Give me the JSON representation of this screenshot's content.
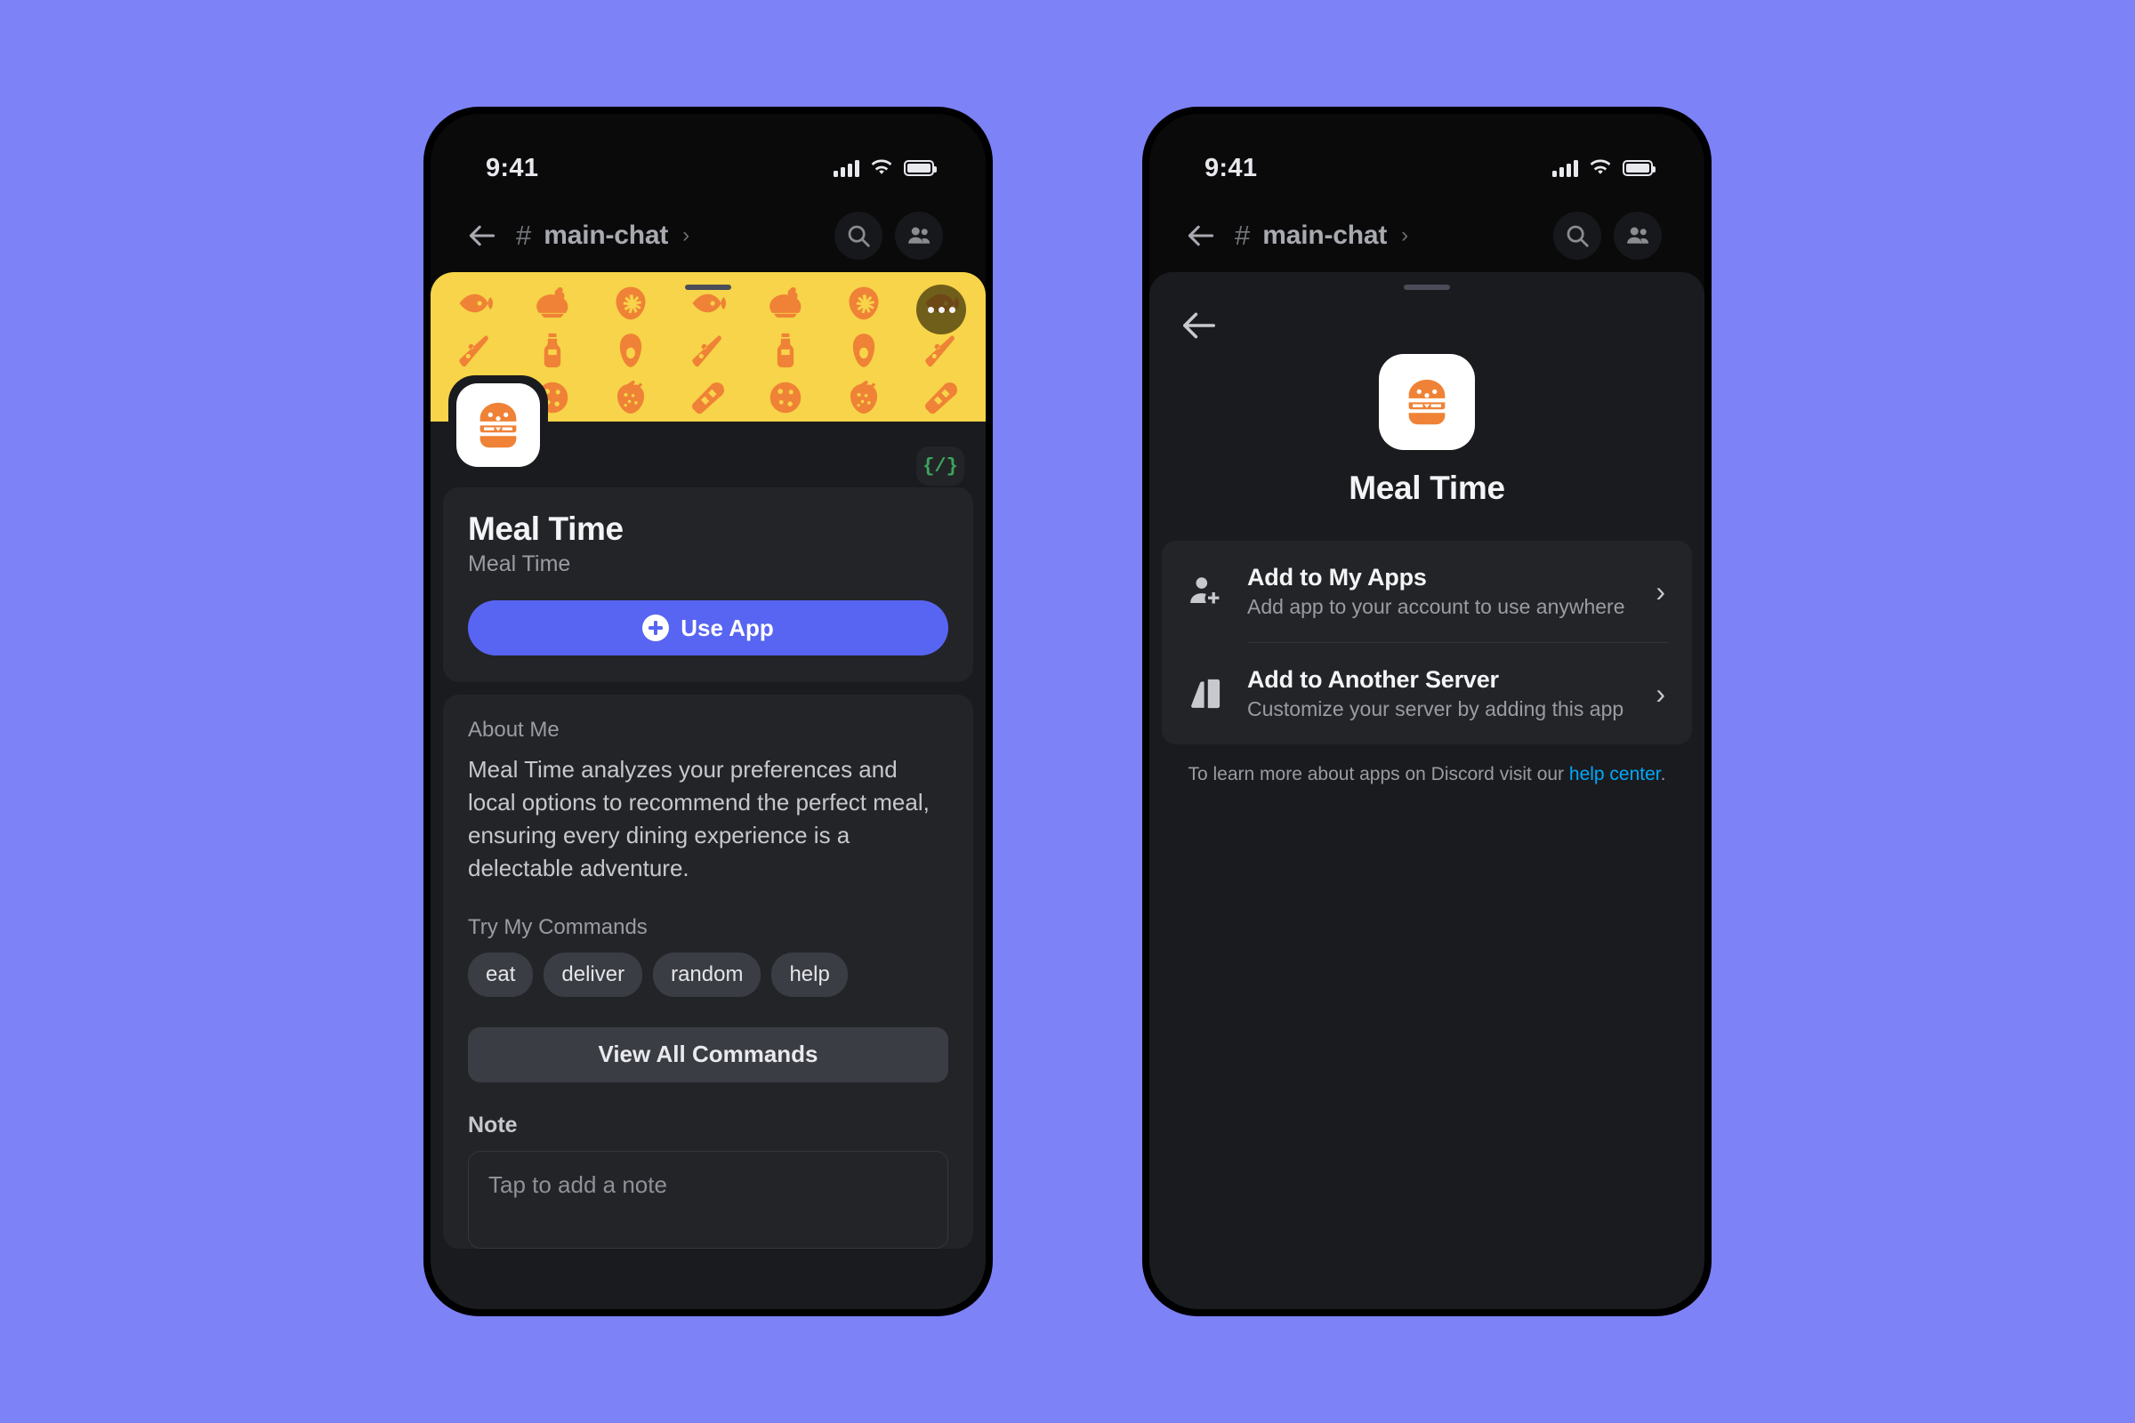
{
  "status_bar": {
    "time": "9:41",
    "signal_icon": "cellular-signal-icon",
    "wifi_icon": "wifi-icon",
    "battery_icon": "battery-icon"
  },
  "channel_header": {
    "back_icon": "back-arrow-icon",
    "hash": "#",
    "channel_name": "main-chat",
    "chevron": "›",
    "search_icon": "search-icon",
    "members_icon": "members-icon"
  },
  "left_phone": {
    "banner": {
      "more_icon": "more-options-icon",
      "food_icons": [
        "fish",
        "chicken",
        "lettuce",
        "fish",
        "chicken",
        "lettuce",
        "fish",
        "pizza",
        "bottle",
        "avocado",
        "pizza",
        "bottle",
        "avocado",
        "pizza",
        "bread",
        "citrus",
        "strawberry",
        "bread",
        "citrus",
        "strawberry",
        "bread"
      ]
    },
    "avatar_icon": "burger-app-avatar",
    "code_badge": "{/}",
    "profile": {
      "title": "Meal Time",
      "subtitle": "Meal Time",
      "use_app_label": "Use App",
      "use_app_icon": "plus-circle-icon",
      "accent_color": "#5865f2"
    },
    "about": {
      "label": "About Me",
      "text": "Meal Time analyzes your preferences and local options to recommend the perfect meal, ensuring every dining experience is a delectable adventure."
    },
    "commands": {
      "label": "Try My Commands",
      "chips": [
        "eat",
        "deliver",
        "random",
        "help"
      ],
      "view_all_label": "View All Commands"
    },
    "note": {
      "label": "Note",
      "placeholder": "Tap to add a note"
    }
  },
  "right_phone": {
    "back_icon": "back-arrow-icon",
    "hero": {
      "avatar_icon": "burger-app-avatar",
      "name": "Meal Time"
    },
    "options": [
      {
        "icon": "add-person-icon",
        "title": "Add to My Apps",
        "description": "Add app to your account to use anywhere",
        "chevron": "›"
      },
      {
        "icon": "server-icon",
        "title": "Add to Another Server",
        "description": "Customize your server by adding this app",
        "chevron": "›"
      }
    ],
    "footnote_prefix": "To learn more about apps on Discord visit our ",
    "footnote_link": "help center",
    "footnote_suffix": "."
  },
  "colors": {
    "background": "#7d82f7",
    "banner": "#f7d449",
    "food": "#ef8236",
    "link": "#00a8fc",
    "code": "#3ba55d"
  }
}
